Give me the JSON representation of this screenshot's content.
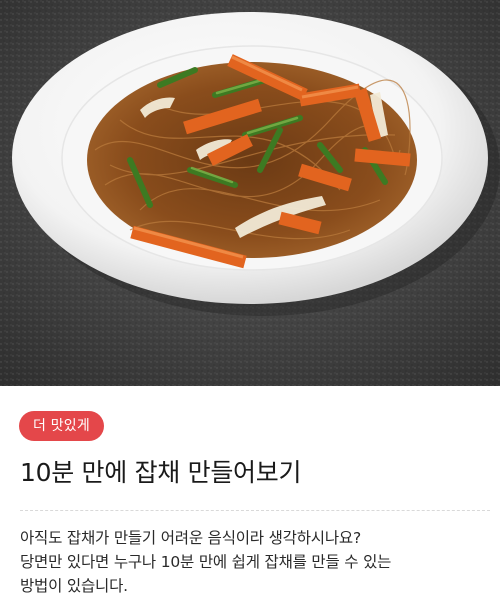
{
  "article": {
    "image_alt": "japchae-dish-photo",
    "tag": "더 맛있게",
    "title": "10분 만에 잡채 만들어보기",
    "description_lines": [
      "아직도 잡채가 만들기 어려운 음식이라 생각하시나요?",
      "당면만 있다면 누구나 10분 만에 쉽게 잡채를 만들 수 있는",
      "방법이 있습니다."
    ]
  },
  "colors": {
    "tag_background": "#e4474a",
    "tag_text": "#ffffff",
    "title_text": "#1a1a1a",
    "body_text": "#2a2a2a"
  }
}
